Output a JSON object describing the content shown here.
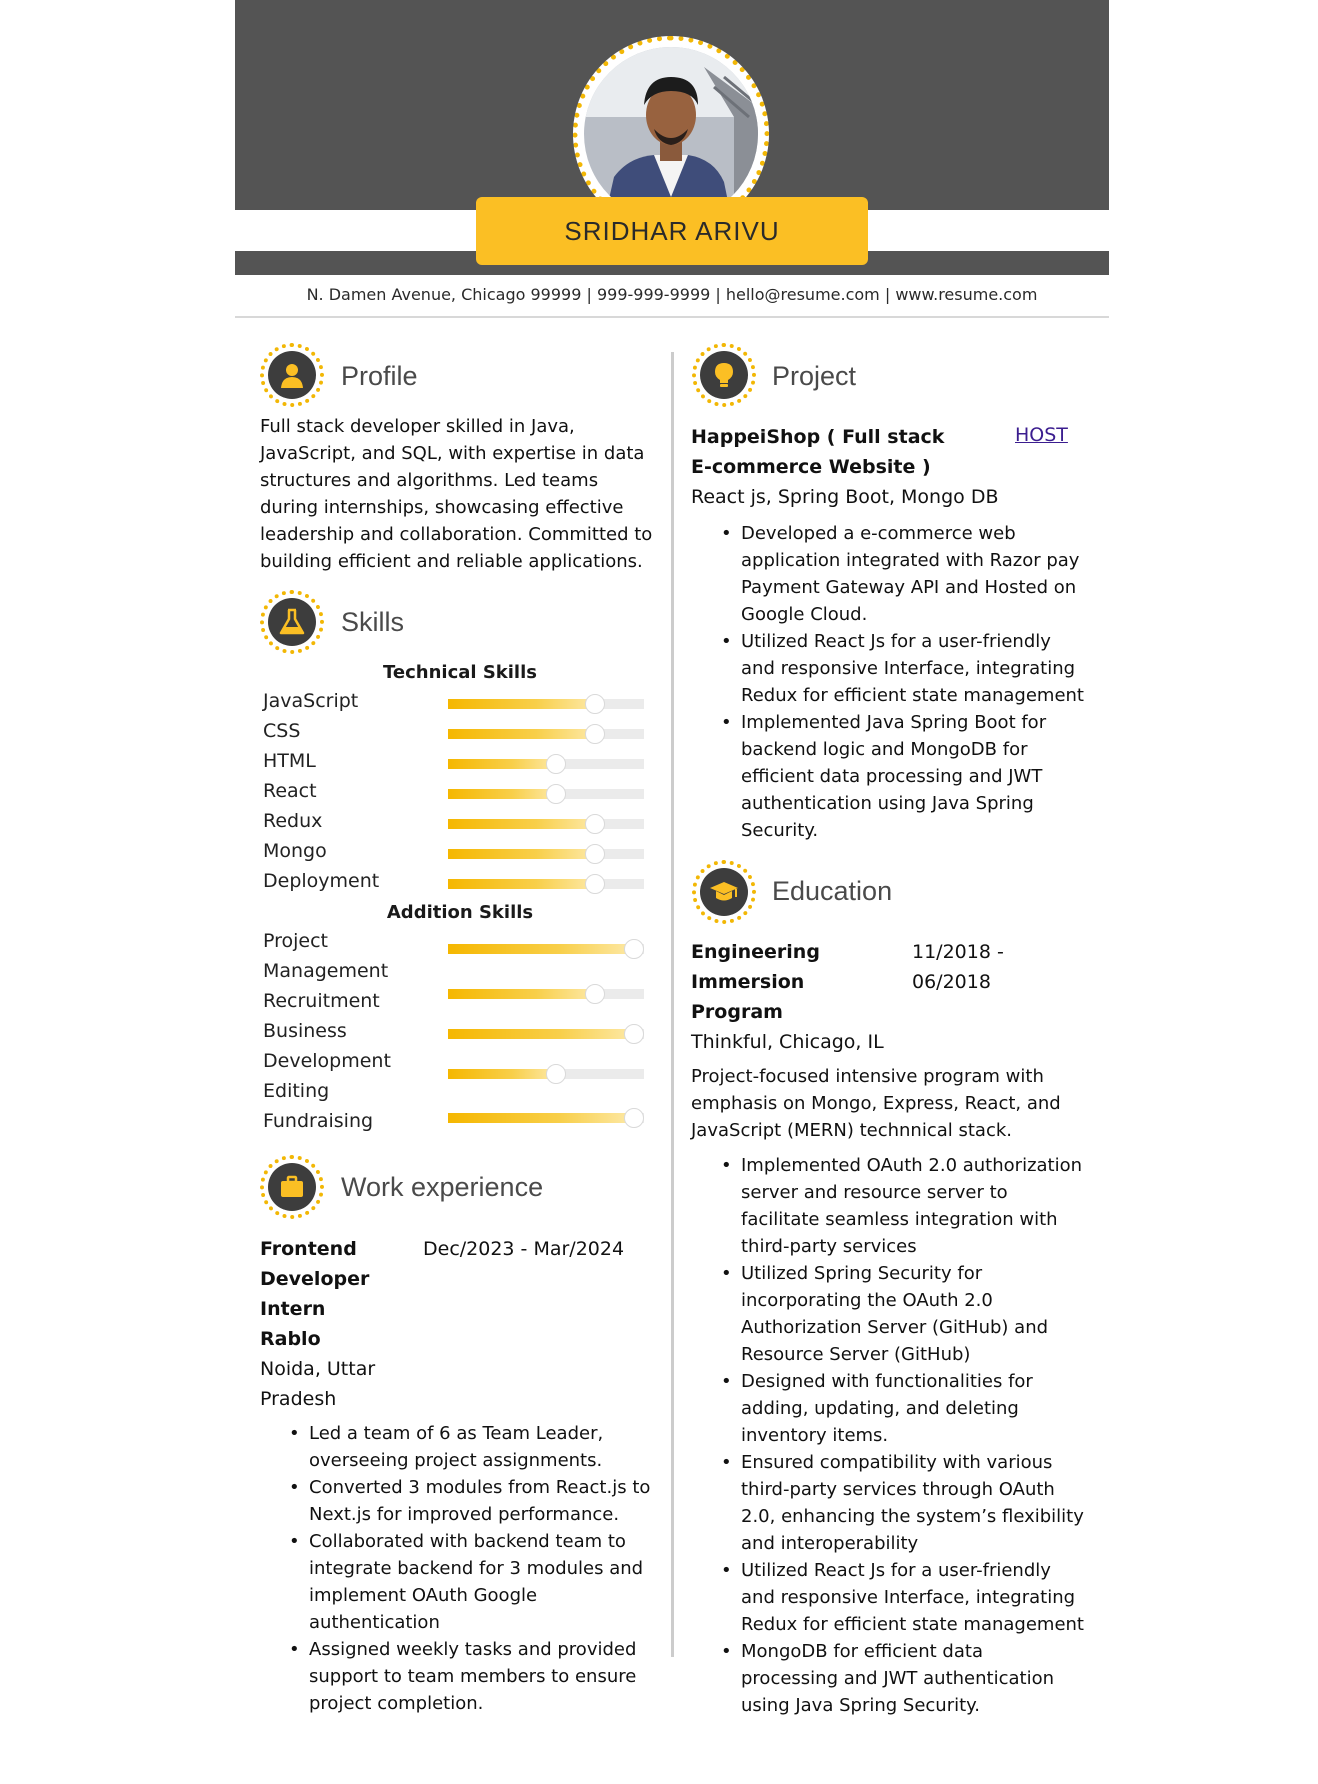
{
  "name": "SRIDHAR ARIVU",
  "contact": "N. Damen Avenue, Chicago 99999 | 999-999-9999 | hello@resume.com | www.resume.com",
  "accent": "#fbbf24",
  "header_color": "#545454",
  "profile": {
    "title": "Profile",
    "lines": [
      "Full stack developer skilled in Java,",
      "JavaScript, and SQL, with expertise in data",
      "structures and algorithms. Led teams",
      "during internships, showcasing effective",
      "leadership and collaboration. Committed to",
      "building efficient and reliable applications."
    ]
  },
  "skills": {
    "title": "Skills",
    "technical_heading": "Technical Skills",
    "technical": [
      {
        "name": "JavaScript",
        "level": 0.75
      },
      {
        "name": "CSS",
        "level": 0.75
      },
      {
        "name": "HTML",
        "level": 0.55
      },
      {
        "name": "React",
        "level": 0.55
      },
      {
        "name": "Redux",
        "level": 0.75
      },
      {
        "name": "Mongo",
        "level": 0.75
      },
      {
        "name": "Deployment",
        "level": 0.75
      }
    ],
    "additional_heading": "Addition Skills",
    "additional": [
      {
        "line1": "Project",
        "line2": "Management",
        "level": 0.95
      },
      {
        "line1": "Recruitment",
        "line2": "",
        "level": 0.75
      },
      {
        "line1": "Business",
        "line2": "Development",
        "level": 0.95
      },
      {
        "line1": "Editing",
        "line2": "",
        "level": 0.55
      },
      {
        "line1": "Fundraising",
        "line2": "",
        "level": 0.95
      }
    ]
  },
  "work": {
    "title": "Work experience",
    "role_lines": [
      "Frontend",
      "Developer",
      "Intern"
    ],
    "dates": "Dec/2023 - Mar/2024",
    "company": "Rablo",
    "location_lines": [
      "Noida, Uttar",
      "Pradesh"
    ],
    "bullets": [
      [
        "Led a team of 6 as Team Leader,",
        "overseeing project assignments."
      ],
      [
        "Converted 3 modules from React.js to",
        "Next.js for improved performance."
      ],
      [
        "Collaborated with backend team to",
        "integrate backend for 3 modules and",
        "implement OAuth Google",
        "authentication"
      ],
      [
        "Assigned weekly tasks and provided",
        "support to team members to ensure",
        "project completion."
      ]
    ]
  },
  "project": {
    "title": "Project",
    "name_lines": [
      "HappeiShop ( Full stack",
      "E-commerce Website )"
    ],
    "link": "HOST",
    "stack": "React js, Spring Boot, Mongo DB",
    "bullets": [
      [
        "Developed a e-commerce web",
        "application integrated with Razor pay",
        "Payment Gateway API and Hosted on",
        "Google Cloud."
      ],
      [
        "Utilized React Js for a user-friendly",
        "and responsive Interface, integrating",
        "Redux for efficient state management"
      ],
      [
        "Implemented Java Spring Boot for",
        "backend logic and MongoDB for",
        "efficient data processing and JWT",
        "authentication using Java Spring",
        "Security."
      ]
    ]
  },
  "education": {
    "title": "Education",
    "program_lines": [
      "Engineering",
      "Immersion",
      "Program"
    ],
    "date_lines": [
      "11/2018 -",
      "06/2018"
    ],
    "school": "Thinkful, Chicago, IL",
    "desc_lines": [
      "Project-focused intensive program with",
      "emphasis on Mongo, Express, React, and",
      "JavaScript (MERN) technnical stack."
    ],
    "bullets": [
      [
        "Implemented OAuth 2.0 authorization",
        "server and resource server to",
        "facilitate seamless integration with",
        "third-party services"
      ],
      [
        "Utilized Spring Security for",
        "incorporating the OAuth 2.0",
        "Authorization Server (GitHub) and",
        "Resource Server (GitHub)"
      ],
      [
        "Designed with functionalities for",
        "adding, updating, and deleting",
        "inventory items."
      ],
      [
        "Ensured compatibility with various",
        "third-party services through OAuth",
        "2.0, enhancing the system’s flexibility",
        "and interoperability"
      ],
      [
        "Utilized React Js for a user-friendly",
        "and responsive Interface, integrating",
        "Redux for efficient state management"
      ],
      [
        "MongoDB for efficient data",
        "processing and JWT authentication",
        "using Java Spring Security."
      ]
    ]
  }
}
